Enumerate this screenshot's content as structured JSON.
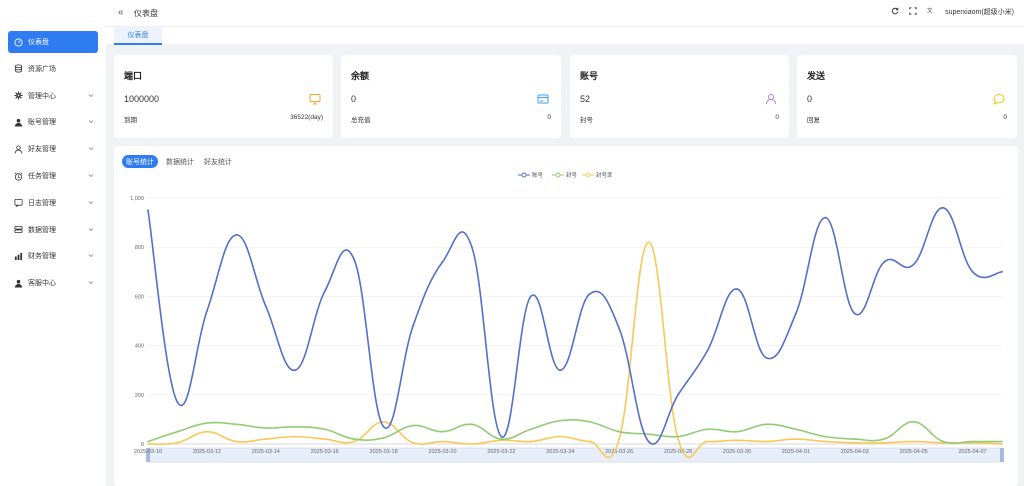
{
  "header": {
    "collapse": "«",
    "title": "仪表盘",
    "user": "superxiaom(超级小米)",
    "icons": [
      "refresh-icon",
      "fullscreen-icon",
      "translate-icon"
    ]
  },
  "tabs": [
    "仪表盘"
  ],
  "sidebar": {
    "items": [
      {
        "label": "仪表盘",
        "icon": "dashboard-icon",
        "active": true,
        "has_children": false
      },
      {
        "label": "资源广场",
        "icon": "database-icon",
        "active": false,
        "has_children": false
      },
      {
        "label": "管理中心",
        "icon": "gear-icon",
        "active": false,
        "has_children": true
      },
      {
        "label": "账号管理",
        "icon": "user-icon",
        "active": false,
        "has_children": true
      },
      {
        "label": "好友管理",
        "icon": "person-icon",
        "active": false,
        "has_children": true
      },
      {
        "label": "任务管理",
        "icon": "clock-icon",
        "active": false,
        "has_children": true
      },
      {
        "label": "日志管理",
        "icon": "log-icon",
        "active": false,
        "has_children": true
      },
      {
        "label": "数据管理",
        "icon": "storage-icon",
        "active": false,
        "has_children": true
      },
      {
        "label": "财务管理",
        "icon": "finance-icon",
        "active": false,
        "has_children": true
      },
      {
        "label": "客服中心",
        "icon": "support-icon",
        "active": false,
        "has_children": true
      }
    ]
  },
  "cards": [
    {
      "title": "端口",
      "value": "1000000",
      "icon": "monitor-icon",
      "icon_color": "#f5a623",
      "foot_label": "到期",
      "foot_value": "36522(day)"
    },
    {
      "title": "余额",
      "value": "0",
      "icon": "card-icon",
      "icon_color": "#3aa0f3",
      "foot_label": "总充值",
      "foot_value": "0"
    },
    {
      "title": "账号",
      "value": "52",
      "icon": "account-icon",
      "icon_color": "#b07ee8",
      "foot_label": "封号",
      "foot_value": "0"
    },
    {
      "title": "发送",
      "value": "0",
      "icon": "message-icon",
      "icon_color": "#f5c518",
      "foot_label": "回复",
      "foot_value": "0"
    }
  ],
  "chart_tabs": [
    {
      "label": "账号统计",
      "active": true
    },
    {
      "label": "数据统计",
      "active": false
    },
    {
      "label": "好友统计",
      "active": false
    }
  ],
  "chart_data": {
    "type": "line",
    "x": [
      "2025-03-10",
      "2025-03-11",
      "2025-03-12",
      "2025-03-13",
      "2025-03-14",
      "2025-03-15",
      "2025-03-16",
      "2025-03-17",
      "2025-03-18",
      "2025-03-19",
      "2025-03-20",
      "2025-03-21",
      "2025-03-22",
      "2025-03-23",
      "2025-03-24",
      "2025-03-25",
      "2025-03-26",
      "2025-03-27",
      "2025-03-28",
      "2025-03-29",
      "2025-03-30",
      "2025-03-31",
      "2025-04-01",
      "2025-04-02",
      "2025-04-03",
      "2025-04-04",
      "2025-04-05",
      "2025-04-06",
      "2025-04-07",
      "2025-04-08"
    ],
    "xticks": [
      "2025-03-10",
      "2025-03-12",
      "2025-03-14",
      "2025-03-16",
      "2025-03-18",
      "2025-03-20",
      "2025-03-22",
      "2025-03-24",
      "2025-03-26",
      "2025-03-28",
      "2025-03-30",
      "2025-04-01",
      "2025-04-03",
      "2025-04-05",
      "2025-04-07"
    ],
    "ylim": [
      0,
      1000
    ],
    "yticks": [
      "0",
      "200",
      "400",
      "600",
      "800",
      "1,000"
    ],
    "grid": true,
    "legend_position": "top-center",
    "series": [
      {
        "name": "账号",
        "color": "#5470c6",
        "values": [
          950,
          170,
          540,
          850,
          560,
          300,
          620,
          750,
          70,
          480,
          740,
          800,
          30,
          600,
          300,
          610,
          470,
          10,
          200,
          380,
          630,
          350,
          530,
          920,
          530,
          740,
          730,
          960,
          700,
          700
        ]
      },
      {
        "name": "封号",
        "color": "#91cc75",
        "values": [
          10,
          50,
          85,
          80,
          65,
          70,
          60,
          20,
          25,
          75,
          50,
          80,
          20,
          60,
          95,
          90,
          50,
          40,
          30,
          60,
          50,
          80,
          60,
          30,
          20,
          20,
          90,
          10,
          10,
          10
        ]
      },
      {
        "name": "封号率",
        "color": "#fac858",
        "values": [
          0,
          5,
          50,
          10,
          20,
          30,
          20,
          10,
          90,
          5,
          10,
          0,
          15,
          10,
          30,
          10,
          20,
          820,
          20,
          10,
          15,
          10,
          20,
          10,
          5,
          5,
          10,
          5,
          5,
          0
        ]
      }
    ]
  }
}
